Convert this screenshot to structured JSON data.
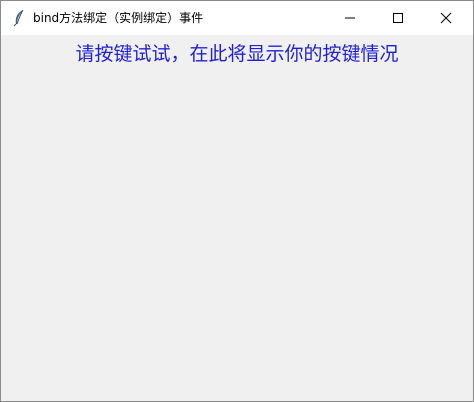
{
  "window": {
    "title": "bind方法绑定（实例绑定）事件",
    "app_icon": "feather-icon",
    "controls": {
      "minimize_icon": "minimize-icon",
      "maximize_icon": "maximize-icon",
      "close_icon": "close-icon"
    }
  },
  "main": {
    "prompt_text": "请按键试试，在此将显示你的按键情况",
    "prompt_color": "#2020dc",
    "background_color": "#f0f0f0"
  }
}
